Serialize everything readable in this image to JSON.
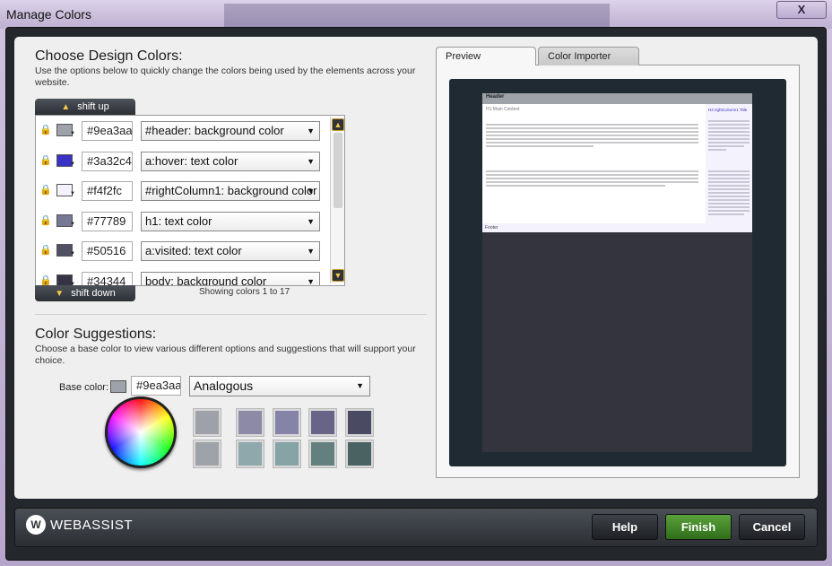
{
  "window": {
    "title": "Manage Colors",
    "close_label": "X"
  },
  "design": {
    "heading": "Choose Design Colors:",
    "description": "Use the options below to quickly change the colors being used by the elements across your website.",
    "shift_up_label": "shift up",
    "shift_down_label": "shift down",
    "showing_text": "Showing colors 1 to 17",
    "rows": [
      {
        "hex": "#9ea3aa",
        "swatch": "#9ea3aa",
        "target": "#header: background color"
      },
      {
        "hex": "#3a32c4",
        "swatch": "#3a32c4",
        "target": "a:hover: text color"
      },
      {
        "hex": "#f4f2fc",
        "swatch": "#f4f2fc",
        "target": "#rightColumn1: background color"
      },
      {
        "hex": "#77789",
        "swatch": "#777894",
        "target": "h1: text color"
      },
      {
        "hex": "#50516",
        "swatch": "#505164",
        "target": "a:visited: text color"
      },
      {
        "hex": "#34344",
        "swatch": "#343444",
        "target": "body: background color"
      }
    ]
  },
  "suggestions": {
    "heading": "Color Suggestions:",
    "description": "Choose a base color to view various different options and suggestions that will support your choice.",
    "base_label": "Base color:",
    "base_hex": "#9ea3aa",
    "base_swatch": "#9ea3aa",
    "scheme": "Analogous",
    "colors_row1": [
      "#9ea0aa",
      "#8c8aa6",
      "#8583a8",
      "#686487",
      "#4b4a63"
    ],
    "colors_row2": [
      "#9ea3aa",
      "#8ea8ab",
      "#86a3a5",
      "#637f7e",
      "#4a6261"
    ]
  },
  "tabs": {
    "preview": "Preview",
    "importer": "Color Importer"
  },
  "preview": {
    "header": "Header",
    "h1": "H1 Main Content",
    "side_title": "H3 rightColumn1 Title",
    "footer": "Footer"
  },
  "footer": {
    "logo_mark": "W",
    "logo_text": "WEBASSIST",
    "help_label": "Help",
    "finish_label": "Finish",
    "cancel_label": "Cancel"
  }
}
